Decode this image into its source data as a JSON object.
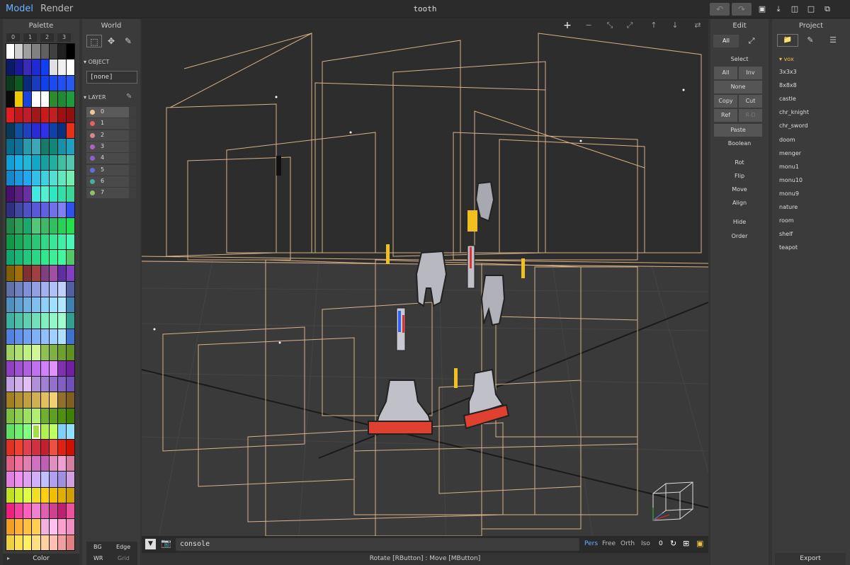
{
  "modes": {
    "model": "Model",
    "render": "Render"
  },
  "file_title": "tooth",
  "toolbar_icons": [
    "undo-icon",
    "redo-icon",
    "save-icon",
    "export-icon",
    "open-folder-icon",
    "new-file-icon",
    "duplicate-icon"
  ],
  "palette": {
    "title": "Palette",
    "tabs": [
      "0",
      "1",
      "2",
      "3"
    ],
    "selected_index": 195,
    "footer": "Color",
    "rows": [
      [
        "#ffffff",
        "#d0d0d0",
        "#a0a0a0",
        "#808080",
        "#606060",
        "#404040",
        "#202020",
        "#000000"
      ],
      [
        "#0a1a66",
        "#1a1a99",
        "#3a2ab8",
        "#1e2ad8",
        "#1040f0",
        "#e0e0e0",
        "#f0f0f0",
        "#ffffff"
      ],
      [
        "#0b3a1e",
        "#0e5a20",
        "#0a2a7a",
        "#1a3abf",
        "#1040e8",
        "#1a4af0",
        "#2050f0",
        "#2858f0"
      ],
      [
        "#0a0a0a",
        "#f0c800",
        "#1844e0",
        "#ffffff",
        "#ffffff",
        "#2b8a2b",
        "#1e8a34",
        "#1c9c3c"
      ],
      [
        "#e02020",
        "#c01818",
        "#c01c2c",
        "#a01818",
        "#c81c1c",
        "#c02020",
        "#a01010",
        "#901010"
      ],
      [
        "#0a3a5a",
        "#1050a0",
        "#2040c0",
        "#2a2ad8",
        "#3030e8",
        "#1040a8",
        "#0c3080",
        "#e83018"
      ],
      [
        "#0a6a8a",
        "#10709a",
        "#2a9aa8",
        "#3aa8b8",
        "#1a7a6a",
        "#108878",
        "#1890a8",
        "#20a0c0"
      ],
      [
        "#10a0d8",
        "#18b0e8",
        "#20b8d8",
        "#10a8c8",
        "#18a0a0",
        "#20b0a0",
        "#40c0a0",
        "#50c8b0"
      ],
      [
        "#1488c8",
        "#1a98e0",
        "#20a8f0",
        "#30c0e8",
        "#40d0e0",
        "#50e0d0",
        "#60e8c0",
        "#70f0b0"
      ],
      [
        "#4a1070",
        "#5a2080",
        "#6a30a0",
        "#40e8e0",
        "#50f0d0",
        "#2ae8c0",
        "#30e0a8",
        "#38d898"
      ],
      [
        "#303080",
        "#4048a0",
        "#5050c8",
        "#5858d8",
        "#6060e0",
        "#7070e8",
        "#8080f0",
        "#3050f0"
      ],
      [
        "#208848",
        "#30a058",
        "#18a870",
        "#50c878",
        "#40b868",
        "#30c060",
        "#28d058",
        "#20e050"
      ],
      [
        "#109848",
        "#18a858",
        "#20b868",
        "#28c878",
        "#30d888",
        "#38e898",
        "#40f0a8",
        "#48f8b8"
      ],
      [
        "#10a870",
        "#18b878",
        "#20c880",
        "#28d888",
        "#30e890",
        "#38f098",
        "#40f8a0",
        "#50c868"
      ],
      [
        "#806000",
        "#a07000",
        "#803030",
        "#a04040",
        "#804080",
        "#a050a0",
        "#6030a0",
        "#8040c0"
      ],
      [
        "#6070a8",
        "#7080c0",
        "#8090d8",
        "#90a0e0",
        "#a0b0f0",
        "#b0c0f8",
        "#c0d0ff",
        "#5060a0"
      ],
      [
        "#5090c0",
        "#60a0d0",
        "#70b0e0",
        "#80c0f0",
        "#90d0f8",
        "#a0e0ff",
        "#b0e8ff",
        "#4080b0"
      ],
      [
        "#40b0a0",
        "#50c0a8",
        "#60d0b0",
        "#70e0b8",
        "#80f0c0",
        "#90f8c8",
        "#a0ffd0",
        "#30a090"
      ],
      [
        "#5080e0",
        "#6090e8",
        "#70a0f0",
        "#80b0f8",
        "#90c0ff",
        "#a0d0ff",
        "#b0e0ff",
        "#4070d0"
      ],
      [
        "#a0d060",
        "#b0e070",
        "#c0f080",
        "#d0f890",
        "#90c050",
        "#80b040",
        "#70a030",
        "#609020"
      ],
      [
        "#9040c0",
        "#a050d0",
        "#b060e0",
        "#c070f0",
        "#d080f8",
        "#e090ff",
        "#8030b0",
        "#7020a0"
      ],
      [
        "#c0a0e0",
        "#d0b0e8",
        "#e0c0f0",
        "#b090d8",
        "#a080d0",
        "#9070c8",
        "#8060c0",
        "#7050b8"
      ],
      [
        "#a08020",
        "#b09030",
        "#c0a040",
        "#d0b050",
        "#e0c060",
        "#f0d070",
        "#90702a",
        "#806020"
      ],
      [
        "#80c040",
        "#90d050",
        "#a0e060",
        "#b0f070",
        "#70b030",
        "#60a020",
        "#509010",
        "#408000"
      ],
      [
        "#60e060",
        "#70f070",
        "#80ff80",
        "#a0e040",
        "#b0f050",
        "#c0ff60",
        "#80d0ff",
        "#90e0ff"
      ],
      [
        "#e03020",
        "#f04030",
        "#e04050",
        "#d03040",
        "#c02030",
        "#f05040",
        "#e02010",
        "#d01000"
      ],
      [
        "#e06080",
        "#f070a0",
        "#e080b0",
        "#d070c0",
        "#c060b0",
        "#e090c0",
        "#f0a0d0",
        "#d080a0"
      ],
      [
        "#e080e0",
        "#f090f0",
        "#e0a0f0",
        "#d0b0f8",
        "#c0c0ff",
        "#b0a0f0",
        "#a090e0",
        "#d0a0e0"
      ],
      [
        "#c0e020",
        "#d0f030",
        "#e0ff40",
        "#f0e020",
        "#ffd010",
        "#f0c000",
        "#e0b000",
        "#d0a000"
      ],
      [
        "#f02080",
        "#f040a0",
        "#ff60c0",
        "#f080d0",
        "#e060b0",
        "#d04090",
        "#c02070",
        "#f050a0"
      ],
      [
        "#f0a020",
        "#ffb030",
        "#ffc040",
        "#ffd050",
        "#f0b0e0",
        "#ffc0f0",
        "#ffa0d0",
        "#f090c0"
      ],
      [
        "#f0d040",
        "#ffe050",
        "#fff060",
        "#ffe080",
        "#ffd0a0",
        "#ffc0b0",
        "#f0a0a0",
        "#e08080"
      ]
    ]
  },
  "world": {
    "title": "World",
    "tool_icons": [
      "select-box-icon",
      "move-icon",
      "pencil-icon"
    ],
    "object_label": "OBJECT",
    "object_value": "[none]",
    "layer_label": "LAYER",
    "layers": [
      {
        "num": "0",
        "color": "#f0c890"
      },
      {
        "num": "1",
        "color": "#e86060"
      },
      {
        "num": "2",
        "color": "#e08090"
      },
      {
        "num": "3",
        "color": "#b060c8"
      },
      {
        "num": "4",
        "color": "#9060d0"
      },
      {
        "num": "5",
        "color": "#6070e0"
      },
      {
        "num": "6",
        "color": "#40b0a8"
      },
      {
        "num": "7",
        "color": "#90c060"
      }
    ],
    "bg_label": "BG",
    "edge_label": "Edge",
    "wr_label": "WR",
    "grid_label": "Grid"
  },
  "viewport": {
    "toolbar_icons": [
      "plus-icon",
      "minus-icon",
      "expand-icon",
      "collapse-icon",
      "arrow-up-icon",
      "arrow-down-icon",
      "swap-icon"
    ],
    "console_text": "console",
    "cam_modes": {
      "pers": "Pers",
      "free": "Free",
      "orth": "Orth",
      "iso": "Iso"
    },
    "zoom_value": "0",
    "status": "Rotate [RButton] : Move [MButton]"
  },
  "edit": {
    "title": "Edit",
    "all_tab": "All",
    "select_label": "Select",
    "all_btn": "All",
    "inv_btn": "Inv",
    "none_btn": "None",
    "copy_btn": "Copy",
    "cut_btn": "Cut",
    "ref_btn": "Ref",
    "rd_btn": "R-D",
    "paste_btn": "Paste",
    "boolean_label": "Boolean",
    "rot_label": "Rot",
    "flip_label": "Flip",
    "move_label": "Move",
    "align_label": "Align",
    "hide_label": "Hide",
    "order_label": "Order"
  },
  "project": {
    "title": "Project",
    "folder": "vox",
    "items": [
      "3x3x3",
      "8x8x8",
      "castle",
      "chr_knight",
      "chr_sword",
      "doom",
      "menger",
      "monu1",
      "monu10",
      "monu9",
      "nature",
      "room",
      "shelf",
      "teapot"
    ],
    "export": "Export"
  },
  "colors": {
    "accent": "#6ab0ff",
    "vox_folder": "#f0c040",
    "wire": "#f0c890"
  }
}
